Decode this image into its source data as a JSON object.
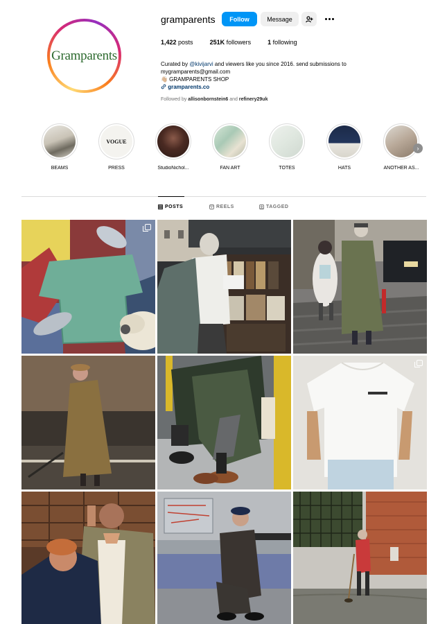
{
  "profile": {
    "username": "gramparents",
    "avatar_text": "Gramparents",
    "follow_label": "Follow",
    "message_label": "Message",
    "stats": [
      {
        "value": "1,422",
        "label": "posts"
      },
      {
        "value": "251K",
        "label": "followers"
      },
      {
        "value": "1",
        "label": "following"
      }
    ],
    "bio": {
      "line1_prefix": "Curated by ",
      "line1_mention": "@kivijarvi",
      "line1_suffix": " and viewers like you since 2016. send submissions to",
      "line2": "mygramparents@gmail.com",
      "line3": "👋🏼 GRAMPARENTS SHOP",
      "link": "gramparents.co"
    },
    "followed_by": {
      "prefix": "Followed by ",
      "user1": "allisonbornstein6",
      "and": " and ",
      "user2": "refinery29uk"
    }
  },
  "highlights": [
    {
      "label": "BEAMS"
    },
    {
      "label": "PRESS"
    },
    {
      "label": "StudioNichol..."
    },
    {
      "label": "FAN ART"
    },
    {
      "label": "TOTES"
    },
    {
      "label": "HATS"
    },
    {
      "label": "ANOTHER AS..."
    }
  ],
  "tabs": [
    {
      "label": "POSTS",
      "icon": "grid-icon"
    },
    {
      "label": "REELS",
      "icon": "reels-icon"
    },
    {
      "label": "TAGGED",
      "icon": "tagged-icon"
    }
  ],
  "colors": {
    "accent": "#0095f6",
    "link": "#00376b",
    "muted": "#737373",
    "border": "#dbdbdb"
  }
}
